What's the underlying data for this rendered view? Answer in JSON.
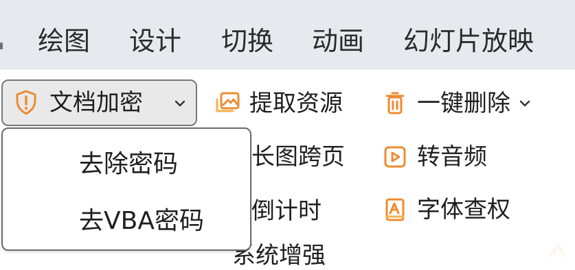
{
  "menu": {
    "items": [
      "绘图",
      "设计",
      "切换",
      "动画",
      "幻灯片放映"
    ]
  },
  "ribbon": {
    "document_encryption": {
      "label": "文档加密",
      "icon": "shield-alert-icon",
      "dropdown_icon": "chevron-down-icon"
    },
    "extract_resources": {
      "label": "提取资源",
      "icon": "image-extract-icon"
    },
    "one_click_delete": {
      "label": "一键删除",
      "icon": "trash-icon",
      "dropdown_icon": "chevron-down-icon"
    },
    "long_image_spread": {
      "label": "长图跨页"
    },
    "to_audio": {
      "label": "转音频",
      "icon": "play-square-icon"
    },
    "countdown": {
      "label": "倒计时"
    },
    "font_copyright": {
      "label": "字体查权",
      "icon": "font-book-icon"
    },
    "system_enhancement": {
      "label": "系统增强"
    }
  },
  "dropdown": {
    "items": [
      "去除密码",
      "去VBA密码"
    ]
  },
  "colors": {
    "menu_background": "#e6eaee",
    "accent_orange": "#ee8b31",
    "border_gray": "#777777",
    "button_active_background": "#e9e9e9"
  }
}
